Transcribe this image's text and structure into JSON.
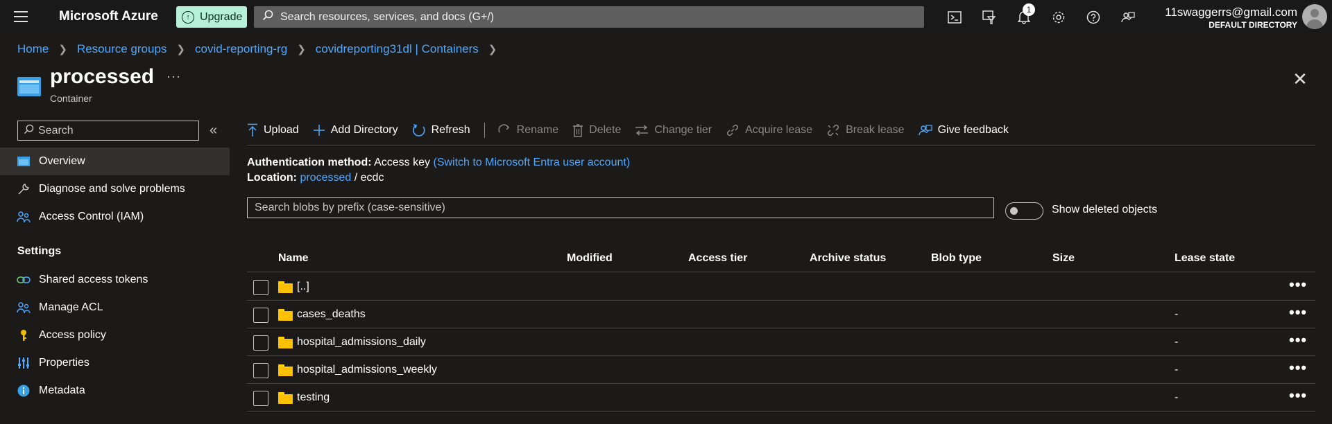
{
  "topbar": {
    "brand": "Microsoft Azure",
    "upgrade_label": "Upgrade",
    "search_placeholder": "Search resources, services, and docs (G+/)",
    "notification_count": "1",
    "account_email": "11swaggerrs@gmail.com",
    "account_directory": "DEFAULT DIRECTORY",
    "icons": [
      "cloud-shell-icon",
      "directory-filter-icon",
      "notifications-icon",
      "settings-icon",
      "help-icon",
      "feedback-icon"
    ]
  },
  "breadcrumb": [
    "Home",
    "Resource groups",
    "covid-reporting-rg",
    "covidreporting31dl | Containers"
  ],
  "resource": {
    "title": "processed",
    "type": "Container"
  },
  "nav": {
    "search_placeholder": "Search",
    "items": [
      "Overview",
      "Diagnose and solve problems",
      "Access Control (IAM)"
    ],
    "settings_header": "Settings",
    "settings_items": [
      "Shared access tokens",
      "Manage ACL",
      "Access policy",
      "Properties",
      "Metadata"
    ]
  },
  "toolbar": {
    "upload": "Upload",
    "add_directory": "Add Directory",
    "refresh": "Refresh",
    "rename": "Rename",
    "delete": "Delete",
    "change_tier": "Change tier",
    "acquire_lease": "Acquire lease",
    "break_lease": "Break lease",
    "give_feedback": "Give feedback"
  },
  "info": {
    "auth_label": "Authentication method:",
    "auth_value": "Access key",
    "auth_switch": "(Switch to Microsoft Entra user account)",
    "location_label": "Location:",
    "location_container": "processed",
    "location_sep": "/",
    "location_path": "ecdc"
  },
  "filter": {
    "blob_search_placeholder": "Search blobs by prefix (case-sensitive)",
    "show_deleted_label": "Show deleted objects",
    "show_deleted": false
  },
  "table": {
    "columns": [
      "Name",
      "Modified",
      "Access tier",
      "Archive status",
      "Blob type",
      "Size",
      "Lease state"
    ],
    "rows": [
      {
        "name": "[..]",
        "lease": ""
      },
      {
        "name": "cases_deaths",
        "lease": "-"
      },
      {
        "name": "hospital_admissions_daily",
        "lease": "-"
      },
      {
        "name": "hospital_admissions_weekly",
        "lease": "-"
      },
      {
        "name": "testing",
        "lease": "-"
      }
    ],
    "row_menu": "•••"
  },
  "colors": {
    "background": "#1b1a19",
    "topbar": "#191919",
    "link": "#4fa8ff",
    "upgrade_bg": "#b7f0d9",
    "folder": "#ffc000",
    "nav_active": "#323130"
  }
}
